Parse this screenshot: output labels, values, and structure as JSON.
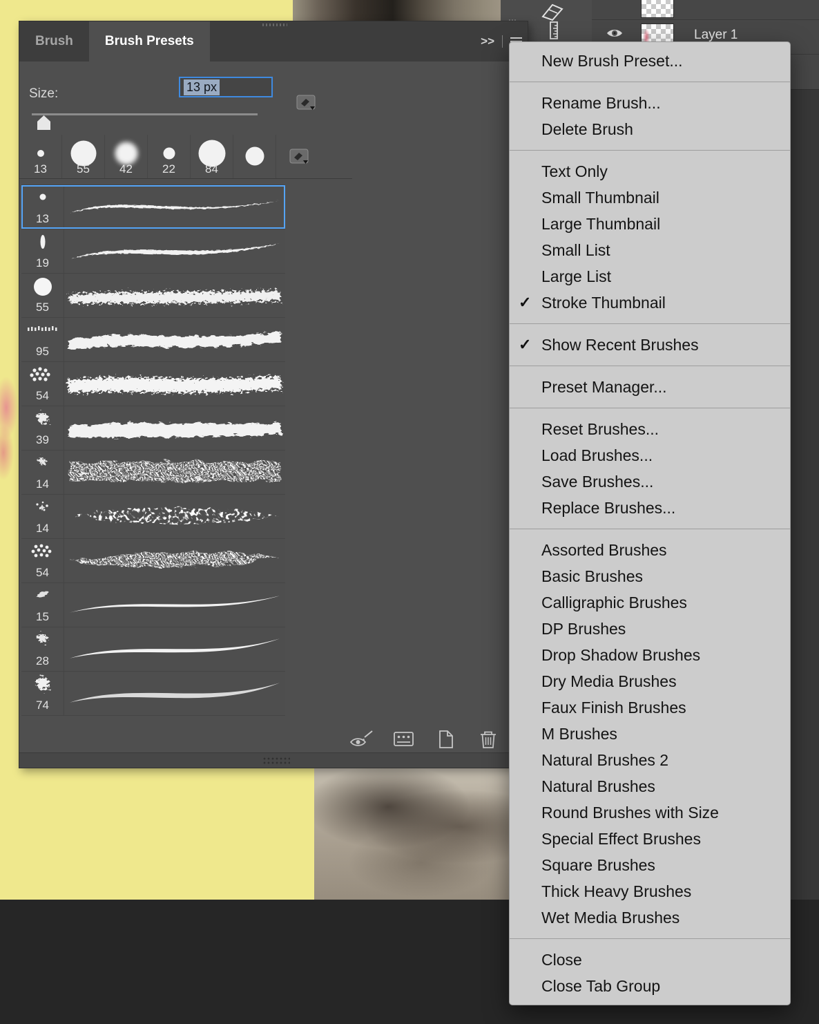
{
  "colors": {
    "accent_blue": "#55a4f6",
    "panel_bg": "#4f4f4f",
    "tab_bar_bg": "#3d3d3d",
    "menu_bg": "#cccccc",
    "canvas_yellow": "#efe88d"
  },
  "panel": {
    "tabs": [
      {
        "label": "Brush",
        "active": false
      },
      {
        "label": "Brush Presets",
        "active": true
      }
    ],
    "collapse_glyph": ">>",
    "size_field": {
      "label": "Size:",
      "value": "13 px"
    },
    "recent_brushes": [
      {
        "size": "13"
      },
      {
        "size": "55"
      },
      {
        "size": "42"
      },
      {
        "size": "22"
      },
      {
        "size": "84"
      },
      {
        "size": ""
      }
    ],
    "presets": [
      {
        "size": "13",
        "selected": true
      },
      {
        "size": "19"
      },
      {
        "size": "55"
      },
      {
        "size": "95"
      },
      {
        "size": "54"
      },
      {
        "size": "39"
      },
      {
        "size": "14"
      },
      {
        "size": "14"
      },
      {
        "size": "54"
      },
      {
        "size": "15"
      },
      {
        "size": "28"
      },
      {
        "size": "74"
      }
    ]
  },
  "layers_panel": {
    "layer_name": "Layer 1"
  },
  "menu": {
    "checkmark": "✓",
    "groups": [
      {
        "items": [
          {
            "label": "New Brush Preset..."
          }
        ]
      },
      {
        "items": [
          {
            "label": "Rename Brush..."
          },
          {
            "label": "Delete Brush"
          }
        ]
      },
      {
        "items": [
          {
            "label": "Text Only"
          },
          {
            "label": "Small Thumbnail"
          },
          {
            "label": "Large Thumbnail"
          },
          {
            "label": "Small List"
          },
          {
            "label": "Large List"
          },
          {
            "label": "Stroke Thumbnail",
            "checked": true
          }
        ]
      },
      {
        "items": [
          {
            "label": "Show Recent Brushes",
            "checked": true
          }
        ]
      },
      {
        "items": [
          {
            "label": "Preset Manager..."
          }
        ]
      },
      {
        "items": [
          {
            "label": "Reset Brushes..."
          },
          {
            "label": "Load Brushes..."
          },
          {
            "label": "Save Brushes..."
          },
          {
            "label": "Replace Brushes..."
          }
        ]
      },
      {
        "items": [
          {
            "label": "Assorted Brushes"
          },
          {
            "label": "Basic Brushes"
          },
          {
            "label": "Calligraphic Brushes"
          },
          {
            "label": "DP Brushes"
          },
          {
            "label": "Drop Shadow Brushes"
          },
          {
            "label": "Dry Media Brushes"
          },
          {
            "label": "Faux Finish Brushes"
          },
          {
            "label": "M Brushes"
          },
          {
            "label": "Natural Brushes 2"
          },
          {
            "label": "Natural Brushes"
          },
          {
            "label": "Round Brushes with Size"
          },
          {
            "label": "Special Effect Brushes"
          },
          {
            "label": "Square Brushes"
          },
          {
            "label": "Thick Heavy Brushes"
          },
          {
            "label": "Wet Media Brushes"
          }
        ]
      },
      {
        "items": [
          {
            "label": "Close"
          },
          {
            "label": "Close Tab Group"
          }
        ]
      }
    ]
  }
}
